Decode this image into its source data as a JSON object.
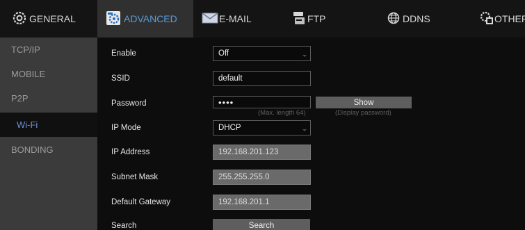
{
  "tabs": [
    {
      "label": "GENERAL",
      "icon": "gear-icon"
    },
    {
      "label": "ADVANCED",
      "icon": "advanced-settings-icon"
    },
    {
      "label": "E-MAIL",
      "icon": "envelope-icon"
    },
    {
      "label": "FTP",
      "icon": "ftp-icon"
    },
    {
      "label": "DDNS",
      "icon": "globe-icon"
    },
    {
      "label": "OTHER",
      "icon": "other-settings-icon"
    }
  ],
  "sidebar": {
    "items": [
      {
        "label": "TCP/IP"
      },
      {
        "label": "MOBILE"
      },
      {
        "label": "P2P"
      },
      {
        "label": "Wi-Fi"
      },
      {
        "label": "BONDING"
      }
    ]
  },
  "form": {
    "enable": {
      "label": "Enable",
      "value": "Off"
    },
    "ssid": {
      "label": "SSID",
      "value": "default"
    },
    "password": {
      "label": "Password",
      "value": "••••",
      "hint": "(Max. length 64)",
      "show_label": "Show",
      "show_hint": "(Display password)"
    },
    "ip_mode": {
      "label": "IP Mode",
      "value": "DHCP"
    },
    "ip_address": {
      "label": "IP Address",
      "value": "192.168.201.123"
    },
    "subnet_mask": {
      "label": "Subnet Mask",
      "value": "255.255.255.0"
    },
    "gateway": {
      "label": "Default Gateway",
      "value": "192.168.201.1"
    },
    "search": {
      "label": "Search",
      "button_label": "Search"
    }
  },
  "colors": {
    "active_tab_text": "#5a9bd8",
    "active_sidebar_text": "#6e8fd8",
    "sidebar_bg": "#3b3b3b",
    "main_bg": "#0d0d0d"
  }
}
